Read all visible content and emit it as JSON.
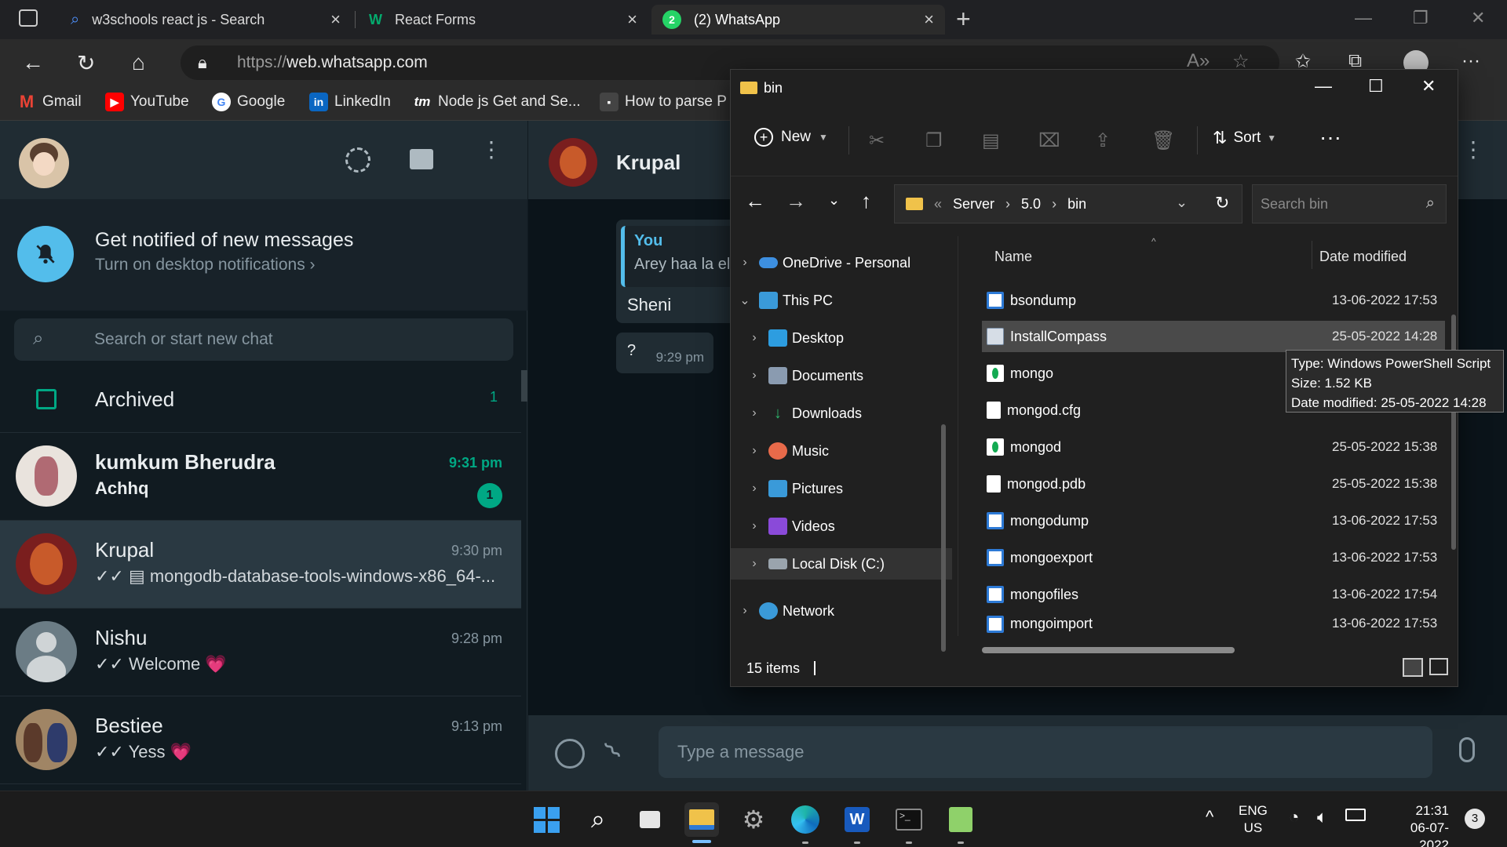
{
  "browser": {
    "tabs": [
      {
        "title": "w3schools react js - Search"
      },
      {
        "title": "React Forms"
      },
      {
        "title": "(2) WhatsApp",
        "active": true
      }
    ],
    "url_scheme": "https://",
    "url_host": "web.whatsapp.com",
    "bookmarks": [
      {
        "label": "Gmail"
      },
      {
        "label": "YouTube"
      },
      {
        "label": "Google"
      },
      {
        "label": "LinkedIn"
      },
      {
        "label": "Node js Get and Se..."
      },
      {
        "label": "How to parse P"
      }
    ]
  },
  "whatsapp": {
    "notify_title": "Get notified of new messages",
    "notify_sub": "Turn on desktop notifications ›",
    "search_placeholder": "Search or start new chat",
    "archived_label": "Archived",
    "archived_count": "1",
    "chats": [
      {
        "name": "kumkum Bherudra",
        "msg": "Achhq",
        "time": "9:31 pm",
        "unread": "1"
      },
      {
        "name": "Krupal",
        "msg": "✓✓ ▤ mongodb-database-tools-windows-x86_64-...",
        "time": "9:30 pm"
      },
      {
        "name": "Nishu",
        "msg": "✓✓ Welcome 💗",
        "time": "9:28 pm"
      },
      {
        "name": "Bestiee",
        "msg": "✓✓ Yess 💗",
        "time": "9:13 pm"
      }
    ],
    "active_chat": "Krupal",
    "quoted_author": "You",
    "quoted_text": "Arey haa la el",
    "bubble_text": "Sheni",
    "bubble2_text": "?",
    "bubble2_time": "9:29 pm",
    "compose_placeholder": "Type a message"
  },
  "explorer": {
    "title": "bin",
    "new_label": "New",
    "sort_label": "Sort",
    "breadcrumb": [
      "Server",
      "5.0",
      "bin"
    ],
    "breadcrumb_prefix": "«",
    "search_placeholder": "Search bin",
    "nav": [
      {
        "label": "OneDrive - Personal"
      },
      {
        "label": "This PC"
      },
      {
        "label": "Desktop"
      },
      {
        "label": "Documents"
      },
      {
        "label": "Downloads"
      },
      {
        "label": "Music"
      },
      {
        "label": "Pictures"
      },
      {
        "label": "Videos"
      },
      {
        "label": "Local Disk (C:)"
      },
      {
        "label": "Network"
      }
    ],
    "col_name": "Name",
    "col_date": "Date modified",
    "files": [
      {
        "name": "bsondump",
        "date": "13-06-2022 17:53"
      },
      {
        "name": "InstallCompass",
        "date": "25-05-2022 14:28"
      },
      {
        "name": "mongo",
        "date": ""
      },
      {
        "name": "mongod.cfg",
        "date": ""
      },
      {
        "name": "mongod",
        "date": "25-05-2022 15:38"
      },
      {
        "name": "mongod.pdb",
        "date": "25-05-2022 15:38"
      },
      {
        "name": "mongodump",
        "date": "13-06-2022 17:53"
      },
      {
        "name": "mongoexport",
        "date": "13-06-2022 17:53"
      },
      {
        "name": "mongofiles",
        "date": "13-06-2022 17:54"
      },
      {
        "name": "mongoimport",
        "date": "13-06-2022 17:53"
      }
    ],
    "status": "15 items",
    "tooltip": {
      "type": "Type: Windows PowerShell Script",
      "size": "Size: 1.52 KB",
      "date": "Date modified: 25-05-2022 14:28"
    }
  },
  "taskbar": {
    "lang_top": "ENG",
    "lang_bottom": "US",
    "time": "21:31",
    "date": "06-07-2022",
    "notif_count": "3"
  }
}
